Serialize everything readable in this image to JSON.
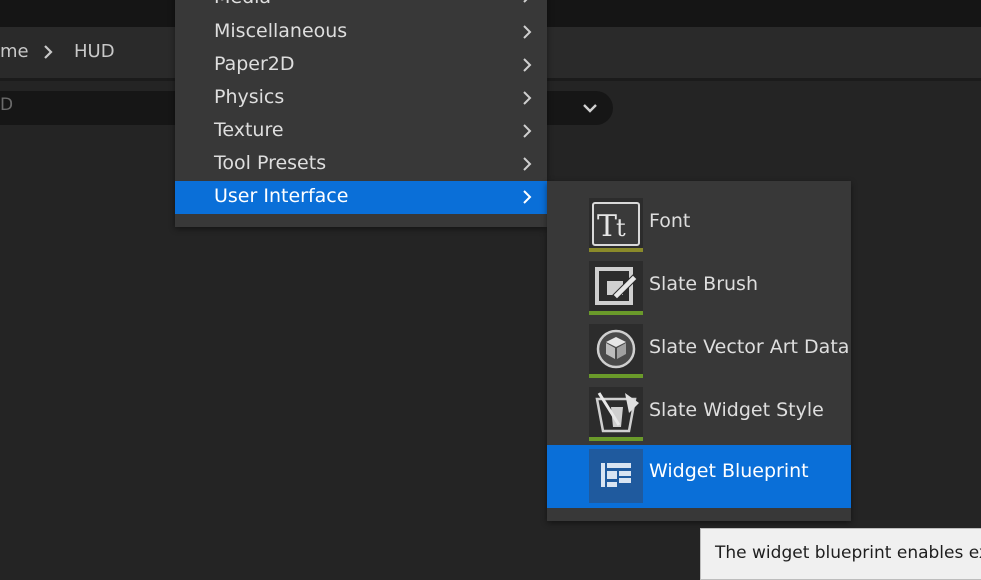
{
  "breadcrumb": {
    "items": [
      "me",
      "HUD"
    ]
  },
  "filter": {
    "text": "D"
  },
  "menu": {
    "items": [
      {
        "label": "Media",
        "has_submenu": true
      },
      {
        "label": "Miscellaneous",
        "has_submenu": true
      },
      {
        "label": "Paper2D",
        "has_submenu": true
      },
      {
        "label": "Physics",
        "has_submenu": true
      },
      {
        "label": "Texture",
        "has_submenu": true
      },
      {
        "label": "Tool Presets",
        "has_submenu": true
      },
      {
        "label": "User Interface",
        "has_submenu": true,
        "active": true
      }
    ]
  },
  "submenu": {
    "items": [
      {
        "label": "Font",
        "icon": "font-icon",
        "bar_color": "#8a8a2a"
      },
      {
        "label": "Slate Brush",
        "icon": "slate-brush-icon",
        "bar_color": "#6a9a2a"
      },
      {
        "label": "Slate Vector Art Data",
        "icon": "cube-icon",
        "bar_color": "#6a9a2a"
      },
      {
        "label": "Slate Widget Style",
        "icon": "widget-style-icon",
        "bar_color": "#6a9a2a"
      },
      {
        "label": "Widget Blueprint",
        "icon": "widget-blueprint-icon",
        "bar_color": "#0a6fd8",
        "active": true
      }
    ]
  },
  "tooltip": {
    "text": "The widget blueprint enables exte"
  },
  "colors": {
    "highlight": "#0a6fd8",
    "menu_bg": "#383838",
    "panel_bg": "#242424"
  }
}
